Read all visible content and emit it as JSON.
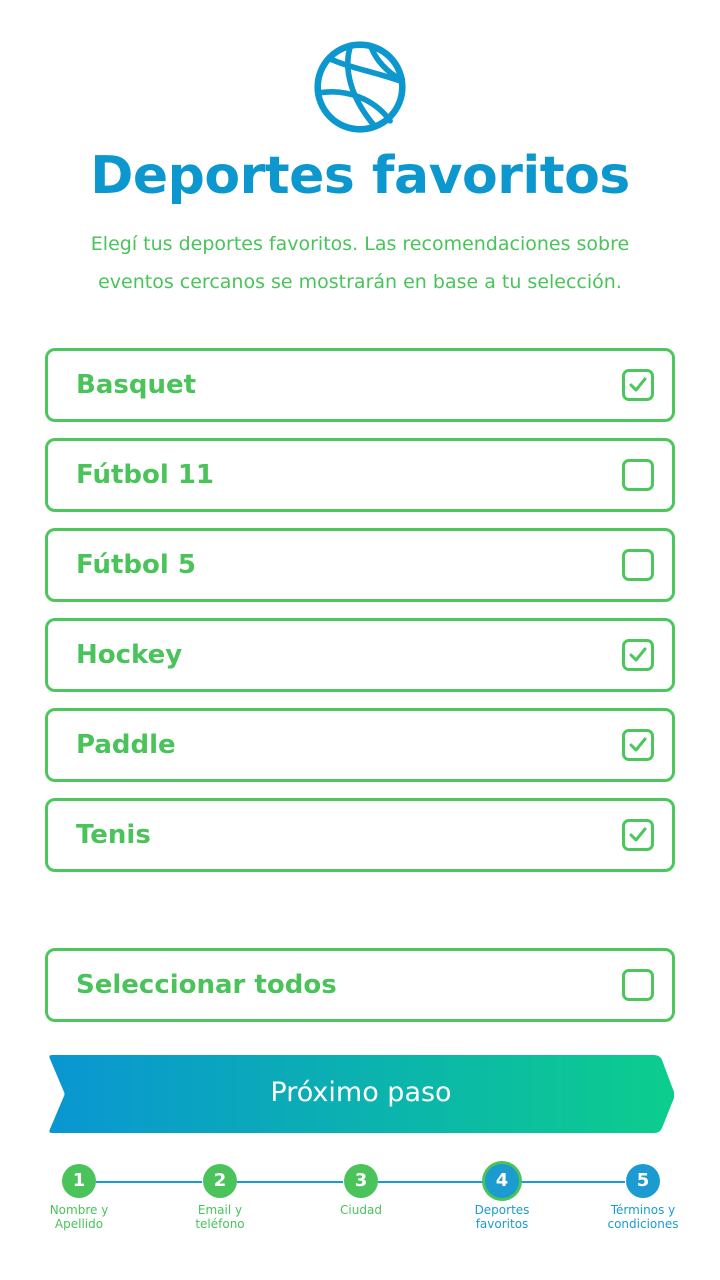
{
  "header": {
    "logo_icon": "basketball-icon",
    "title": "Deportes favoritos",
    "subtitle": "Elegí tus deportes favoritos. Las recomendaciones sobre eventos cercanos se mostrarán en base a tu selección."
  },
  "sports": [
    {
      "label": "Basquet",
      "checked": true
    },
    {
      "label": "Fútbol 11",
      "checked": false
    },
    {
      "label": "Fútbol 5",
      "checked": false
    },
    {
      "label": "Hockey",
      "checked": true
    },
    {
      "label": "Paddle",
      "checked": true
    },
    {
      "label": "Tenis",
      "checked": true
    }
  ],
  "select_all": {
    "label": "Seleccionar todos",
    "checked": false
  },
  "next_button": {
    "label": "Próximo paso"
  },
  "stepper": {
    "steps": [
      {
        "number": "1",
        "label": "Nombre y\nApellido",
        "state": "done"
      },
      {
        "number": "2",
        "label": "Email y\nteléfono",
        "state": "done"
      },
      {
        "number": "3",
        "label": "Ciudad",
        "state": "done"
      },
      {
        "number": "4",
        "label": "Deportes\nfavoritos",
        "state": "current"
      },
      {
        "number": "5",
        "label": "Términos y\ncondiciones",
        "state": "future"
      }
    ]
  },
  "colors": {
    "primary_blue": "#0d97cf",
    "accent_green": "#49c35a",
    "gradient_start": "#0a96d2",
    "gradient_end": "#0ccd8d"
  }
}
